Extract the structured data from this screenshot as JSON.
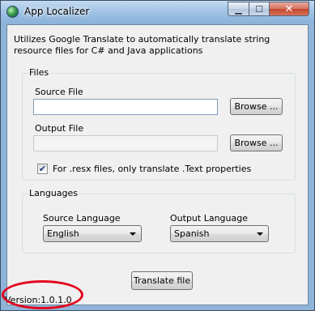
{
  "window": {
    "title": "App Localizer",
    "app_icon": "globe-icon",
    "controls": {
      "minimize": "▁",
      "maximize": "☐",
      "close": "✕"
    }
  },
  "description": "Utilizes Google Translate to automatically translate string resource files for C# and Java applications",
  "files_group": {
    "label": "Files",
    "source_file_label": "Source File",
    "source_file_value": "",
    "output_file_label": "Output File",
    "output_file_value": "",
    "browse_label": "Browse ...",
    "resx_checkbox_checked": true,
    "resx_checkbox_label": "For .resx files, only translate .Text properties"
  },
  "languages_group": {
    "label": "Languages",
    "source_language_label": "Source Language",
    "source_language_value": "English",
    "output_language_label": "Output Language",
    "output_language_value": "Spanish"
  },
  "translate_button_label": "Translate file",
  "version_text": "Version:1.0.1.0",
  "colors": {
    "annotation": "#e3001b"
  }
}
